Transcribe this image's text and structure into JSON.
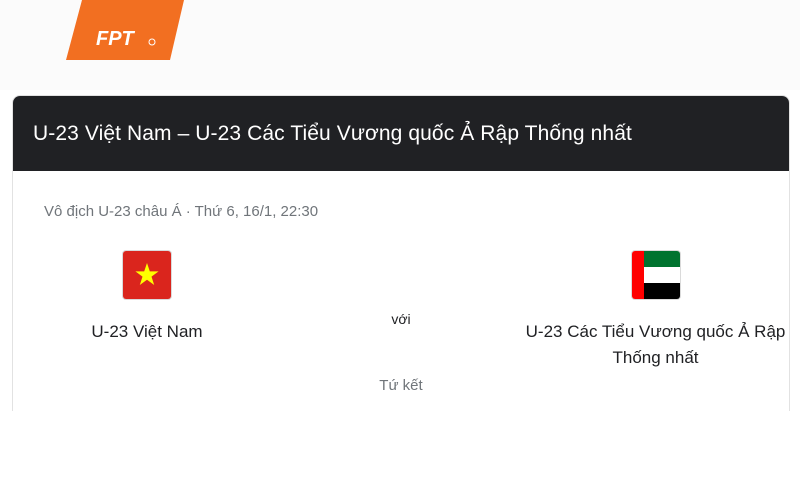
{
  "brand": {
    "logo_text": "FPT",
    "logo_color": "#f26f21"
  },
  "match": {
    "title": "U-23 Việt Nam – U-23 Các Tiểu Vương quốc Ả Rập Thống nhất",
    "meta": "Vô địch U-23 châu Á · Thứ 6, 16/1, 22:30",
    "versus": "với",
    "stage": "Tứ kết",
    "home": {
      "name": "U-23 Việt Nam",
      "flag_icon": "vietnam-flag-icon"
    },
    "away": {
      "name": "U-23 Các Tiểu Vương quốc Ả Rập Thống nhất",
      "flag_icon": "uae-flag-icon"
    }
  },
  "colors": {
    "header_bg": "#202124",
    "vn_red": "#da251d",
    "vn_star": "#ffff00",
    "uae_red": "#ff0000",
    "uae_green": "#00732f",
    "uae_black": "#000000"
  }
}
